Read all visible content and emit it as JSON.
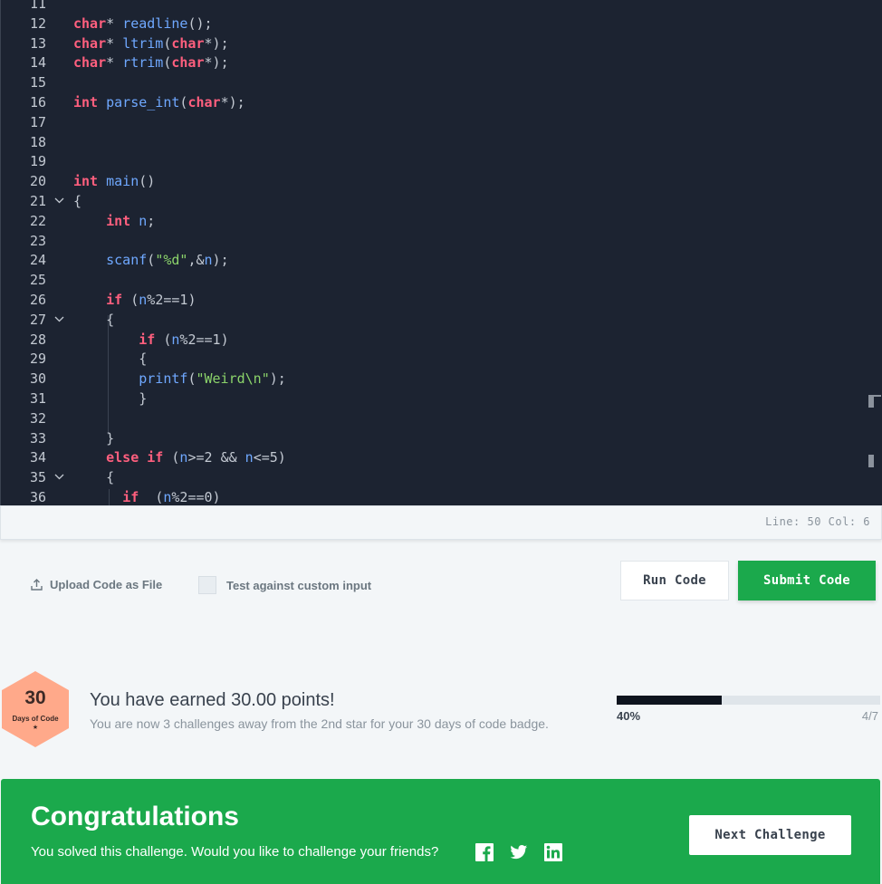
{
  "editor": {
    "lines": [
      {
        "n": "11",
        "code": ""
      },
      {
        "n": "12",
        "code": "char* readline();"
      },
      {
        "n": "13",
        "code": "char* ltrim(char*);"
      },
      {
        "n": "14",
        "code": "char* rtrim(char*);"
      },
      {
        "n": "15",
        "code": ""
      },
      {
        "n": "16",
        "code": "int parse_int(char*);"
      },
      {
        "n": "17",
        "code": ""
      },
      {
        "n": "18",
        "code": ""
      },
      {
        "n": "19",
        "code": ""
      },
      {
        "n": "20",
        "code": "int main()"
      },
      {
        "n": "21",
        "code": "{"
      },
      {
        "n": "22",
        "code": "    int n;"
      },
      {
        "n": "23",
        "code": ""
      },
      {
        "n": "24",
        "code": "    scanf(\"%d\",&n);"
      },
      {
        "n": "25",
        "code": ""
      },
      {
        "n": "26",
        "code": "    if (n%2==1)"
      },
      {
        "n": "27",
        "code": "    {"
      },
      {
        "n": "28",
        "code": "        if (n%2==1)"
      },
      {
        "n": "29",
        "code": "        {"
      },
      {
        "n": "30",
        "code": "        printf(\"Weird\\n\");"
      },
      {
        "n": "31",
        "code": "        }"
      },
      {
        "n": "32",
        "code": ""
      },
      {
        "n": "33",
        "code": "    }"
      },
      {
        "n": "34",
        "code": "    else if (n>=2 && n<=5)"
      },
      {
        "n": "35",
        "code": "    {"
      },
      {
        "n": "36",
        "code": "      if  (n%2==0)"
      }
    ],
    "fold_lines": [
      "21",
      "27",
      "35"
    ]
  },
  "statusbar": {
    "position": "Line: 50 Col: 6"
  },
  "actions": {
    "upload_label": "Upload Code as File",
    "custom_input_label": "Test against custom input",
    "run_label": "Run Code",
    "submit_label": "Submit Code"
  },
  "points": {
    "badge_number": "30",
    "badge_label": "Days of Code",
    "badge_star": "★",
    "earned_text": "You have earned 30.00 points!",
    "subtext": "You are now 3 challenges away from the 2nd star for your 30 days of code badge.",
    "progress_fraction": 0.4,
    "progress_percent_label": "40%",
    "progress_count": "4/7"
  },
  "congrats": {
    "title": "Congratulations",
    "subtitle": "You solved this challenge. Would you like to challenge your friends?",
    "next_label": "Next Challenge"
  },
  "colors": {
    "editor_bg": "#1c2331",
    "keyword": "#ff5f7e",
    "function": "#6fa8ff",
    "string": "#8bd36a",
    "success_green": "#1ba94c",
    "badge_orange": "#ffa98a"
  },
  "icons": [
    "upload-icon",
    "chevron-down-icon",
    "facebook-icon",
    "twitter-icon",
    "linkedin-icon"
  ]
}
